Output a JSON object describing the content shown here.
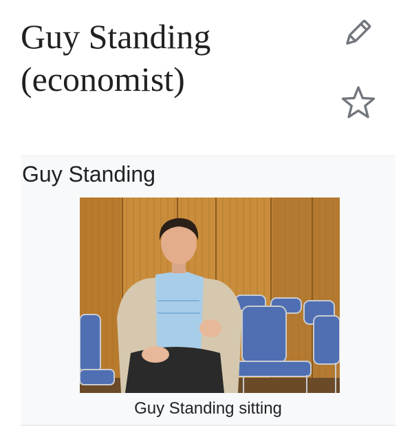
{
  "article": {
    "title_lines": [
      "Guy Standing",
      "(economist)"
    ]
  },
  "actions": {
    "edit_icon": "pencil-icon",
    "watch_icon": "star-outline-icon"
  },
  "infobox": {
    "name": "Guy Standing",
    "image_caption": "Guy Standing sitting"
  },
  "colors": {
    "text": "#202122",
    "icon": "#72777d",
    "infobox_background": "#f8f9fa",
    "photo_wall": "#c98d3c",
    "chair_blue": "#4f6fb2"
  }
}
